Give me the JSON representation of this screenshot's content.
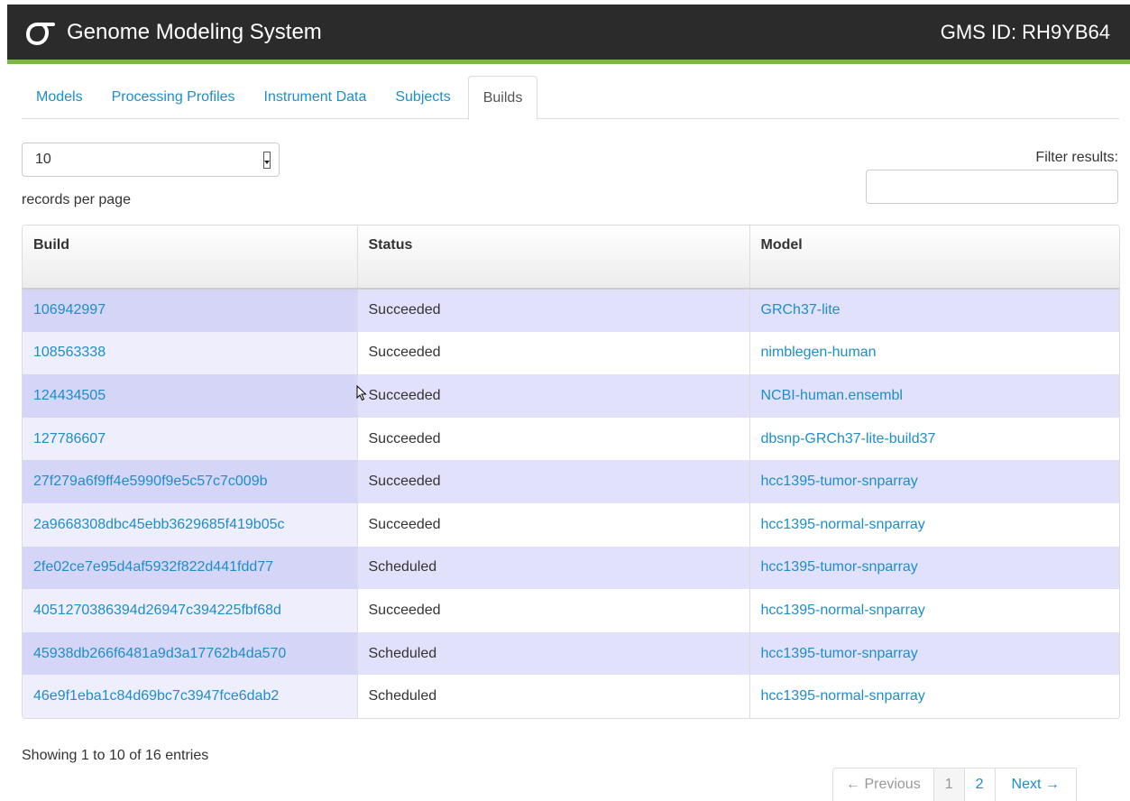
{
  "header": {
    "brand_title": "Genome Modeling System",
    "gms_id": "GMS ID: RH9YB64",
    "logo_icon": "sigma-logo-icon",
    "accent_color": "#7ab648",
    "bar_color": "#2b2b2b"
  },
  "tabs": [
    {
      "label": "Models",
      "active": false
    },
    {
      "label": "Processing Profiles",
      "active": false
    },
    {
      "label": "Instrument Data",
      "active": false
    },
    {
      "label": "Subjects",
      "active": false
    },
    {
      "label": "Builds",
      "active": true
    }
  ],
  "controls": {
    "records_per_page_value": "10",
    "records_per_page_label": "records per page",
    "filter_label": "Filter results:",
    "filter_value": ""
  },
  "table": {
    "columns": [
      "Build",
      "Status",
      "Model"
    ],
    "rows": [
      {
        "build": "106942997",
        "status": "Succeeded",
        "model": "GRCh37-lite"
      },
      {
        "build": "108563338",
        "status": "Succeeded",
        "model": "nimblegen-human"
      },
      {
        "build": "124434505",
        "status": "Succeeded",
        "model": "NCBI-human.ensembl"
      },
      {
        "build": "127786607",
        "status": "Succeeded",
        "model": "dbsnp-GRCh37-lite-build37"
      },
      {
        "build": "27f279a6f9ff4e5990f9e5c57c7c009b",
        "status": "Succeeded",
        "model": "hcc1395-tumor-snparray"
      },
      {
        "build": "2a9668308dbc45ebb3629685f419b05c",
        "status": "Succeeded",
        "model": "hcc1395-normal-snparray"
      },
      {
        "build": "2fe02ce7e95d4af5932f822d441fdd77",
        "status": "Scheduled",
        "model": "hcc1395-tumor-snparray"
      },
      {
        "build": "4051270386394d26947c394225fbf68d",
        "status": "Succeeded",
        "model": "hcc1395-normal-snparray"
      },
      {
        "build": "45938db266f6481a9d3a17762b4da570",
        "status": "Scheduled",
        "model": "hcc1395-tumor-snparray"
      },
      {
        "build": "46e9f1eba1c84d69bc7c3947fce6dab2",
        "status": "Scheduled",
        "model": "hcc1395-normal-snparray"
      }
    ]
  },
  "footer": {
    "info": "Showing 1 to 10 of 16 entries",
    "pagination": {
      "previous": "← Previous",
      "pages": [
        "1",
        "2"
      ],
      "current": "1",
      "next": "Next →"
    }
  }
}
